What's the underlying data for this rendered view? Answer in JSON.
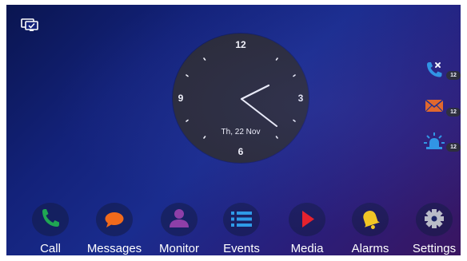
{
  "status": {
    "icon": "monitor-check-icon"
  },
  "clock": {
    "numbers": {
      "top": "12",
      "right": "3",
      "bottom": "6",
      "left": "9"
    },
    "date": "Th, 22 Nov"
  },
  "notifications": [
    {
      "icon": "missed-call-icon",
      "count": "12",
      "color": "#2e9be8"
    },
    {
      "icon": "envelope-icon",
      "count": "12",
      "color": "#f26a1b"
    },
    {
      "icon": "alarm-light-icon",
      "count": "12",
      "color": "#2e9be8"
    }
  ],
  "dock": [
    {
      "label": "Call",
      "icon": "phone-icon",
      "color": "#1fa653"
    },
    {
      "label": "Messages",
      "icon": "chat-bubble-icon",
      "color": "#f26a1b"
    },
    {
      "label": "Monitor",
      "icon": "person-icon",
      "color": "#8e3fa8"
    },
    {
      "label": "Events",
      "icon": "list-icon",
      "color": "#2e9be8"
    },
    {
      "label": "Media",
      "icon": "play-icon",
      "color": "#e8212b"
    },
    {
      "label": "Alarms",
      "icon": "bell-icon",
      "color": "#f4c623"
    },
    {
      "label": "Settings",
      "icon": "gear-icon",
      "color": "#b9bcc8"
    }
  ]
}
